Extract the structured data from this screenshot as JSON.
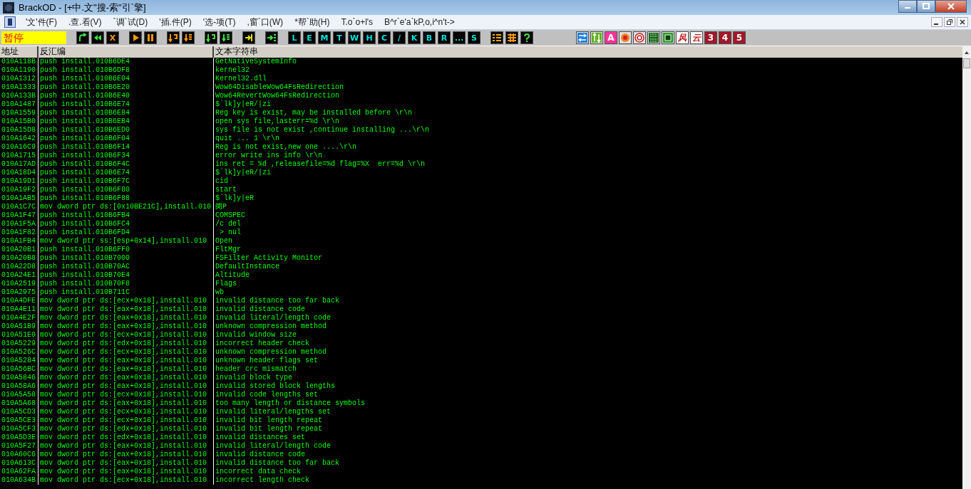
{
  "window": {
    "title": "BrackOD - [+中.文\"搜-索\"引`擎]"
  },
  "menu": [
    "'文'件(F)",
    ".查.看(V)",
    "`调`试(D)",
    "'插.件(P)",
    "'选-项(T)",
    ",窗`口(W)",
    "*帮`助(H)",
    "T.o`o+l's",
    "B^r`e'a`kP,o,i^n't->"
  ],
  "status": "暂停",
  "toolbar": [
    [
      {
        "kind": "curve-arrow"
      },
      {
        "kind": "rewind"
      },
      {
        "kind": "warn-letter",
        "label": "X"
      }
    ],
    [
      {
        "kind": "play"
      },
      {
        "kind": "pause"
      }
    ],
    [
      {
        "kind": "step-in"
      },
      {
        "kind": "step-over"
      }
    ],
    [
      {
        "kind": "trace-in"
      },
      {
        "kind": "trace-over"
      }
    ],
    [
      {
        "kind": "return"
      }
    ],
    [
      {
        "kind": "goto"
      }
    ],
    [
      {
        "kind": "letter",
        "label": "L"
      },
      {
        "kind": "letter",
        "label": "E"
      },
      {
        "kind": "letter",
        "label": "M"
      },
      {
        "kind": "letter",
        "label": "T"
      },
      {
        "kind": "letter",
        "label": "W"
      },
      {
        "kind": "letter",
        "label": "H"
      },
      {
        "kind": "letter",
        "label": "C"
      },
      {
        "kind": "letter",
        "label": "/"
      },
      {
        "kind": "letter",
        "label": "K"
      },
      {
        "kind": "letter",
        "label": "B"
      },
      {
        "kind": "letter",
        "label": "R"
      },
      {
        "kind": "letter",
        "label": "..."
      },
      {
        "kind": "letter",
        "label": "S"
      }
    ],
    [
      {
        "kind": "list"
      },
      {
        "kind": "grid"
      },
      {
        "kind": "help"
      }
    ]
  ],
  "toolbar_right": [
    {
      "kind": "swap"
    },
    {
      "kind": "updown"
    },
    {
      "kind": "badge",
      "label": "A",
      "color": "#ff3399"
    },
    {
      "kind": "record"
    },
    {
      "kind": "target"
    },
    {
      "kind": "binary"
    },
    {
      "kind": "chip"
    },
    {
      "kind": "calligraphy",
      "label": "风"
    },
    {
      "kind": "calligraphy",
      "label": "云"
    },
    {
      "kind": "badge",
      "label": "3",
      "color": "#a01828"
    },
    {
      "kind": "badge",
      "label": "4",
      "color": "#a01828"
    },
    {
      "kind": "badge",
      "label": "5",
      "color": "#a01828"
    }
  ],
  "table": {
    "columns": [
      "地址",
      "反汇编",
      "文本字符串"
    ],
    "rows": [
      [
        "010A118B",
        "push install.010B6DE4",
        "GetNativeSystemInfo"
      ],
      [
        "010A1190",
        "push install.010B6DF8",
        "kernel32"
      ],
      [
        "010A1312",
        "push install.010B6E04",
        "Kernel32.dll"
      ],
      [
        "010A1333",
        "push install.010B6E20",
        "Wow64DisableWow64FsRedirection"
      ],
      [
        "010A133B",
        "push install.010B6E40",
        "Wow64RevertWow64FsRedirection"
      ],
      [
        "010A1487",
        "push install.010B6E74",
        "$`lk]y|eR/|zi"
      ],
      [
        "010A1559",
        "push install.010B6E84",
        "Reg key is exist, may be installed before \\r\\n"
      ],
      [
        "010A15B0",
        "push install.010B6EB4",
        "open sys file,lasterr=%d \\r\\n"
      ],
      [
        "010A15D8",
        "push install.010B6ED0",
        "sys file is not exist ,continue installing ...\\r\\n"
      ],
      [
        "010A1642",
        "push install.010B6F04",
        "quit ... 1 \\r\\n"
      ],
      [
        "010A16C9",
        "push install.010B6F14",
        "Reg is not exist,new one ....\\r\\n"
      ],
      [
        "010A1715",
        "push install.010B6F34",
        "error write ins info \\r\\n"
      ],
      [
        "010A17AD",
        "push install.010B6F4C",
        "ins ret = %d ,releasefile=%d flag=%X  err=%d \\r\\n"
      ],
      [
        "010A18D4",
        "push install.010B6E74",
        "$`lk]y|eR/|zi"
      ],
      [
        "010A19D1",
        "push install.010B6F7C",
        "cid"
      ],
      [
        "010A19F2",
        "push install.010B6F80",
        "start"
      ],
      [
        "010A1AB5",
        "push install.010B6F88",
        "$`lk]y|eR"
      ],
      [
        "010A1C7C",
        "mov dword ptr ds:[0x10BE21C],install.010",
        "阌P"
      ],
      [
        "010A1F47",
        "push install.010B6FB4",
        "COMSPEC"
      ],
      [
        "010A1F5A",
        "push install.010B6FC4",
        "/c del"
      ],
      [
        "010A1F82",
        "push install.010B6FD4",
        " > nul"
      ],
      [
        "010A1FB4",
        "mov dword ptr ss:[esp+0x14],install.010",
        "Open"
      ],
      [
        "010A20B1",
        "push install.010B6FF0",
        "FltMgr"
      ],
      [
        "010A20B8",
        "push install.010B7000",
        "FSFilter Activity Monitor"
      ],
      [
        "010A22D8",
        "push install.010B70AC",
        "DefaultInstance"
      ],
      [
        "010A24E1",
        "push install.010B70E4",
        "Altitude"
      ],
      [
        "010A2519",
        "push install.010B70F8",
        "Flags"
      ],
      [
        "010A2975",
        "push install.010B711C",
        "wb"
      ],
      [
        "010A4DFE",
        "mov dword ptr ds:[ecx+0x18],install.010",
        "invalid distance too far back"
      ],
      [
        "010A4E11",
        "mov dword ptr ds:[eax+0x18],install.010",
        "invalid distance code"
      ],
      [
        "010A4E2F",
        "mov dword ptr ds:[eax+0x18],install.010",
        "invalid literal/length code"
      ],
      [
        "010A51B9",
        "mov dword ptr ds:[eax+0x18],install.010",
        "unknown compression method"
      ],
      [
        "010A51E0",
        "mov dword ptr ds:[ecx+0x18],install.010",
        "invalid window size"
      ],
      [
        "010A5229",
        "mov dword ptr ds:[edx+0x18],install.010",
        "incorrect header check"
      ],
      [
        "010A526C",
        "mov dword ptr ds:[ecx+0x18],install.010",
        "unknown compression method"
      ],
      [
        "010A5284",
        "mov dword ptr ds:[eax+0x18],install.010",
        "unknown header flags set"
      ],
      [
        "010A56BC",
        "mov dword ptr ds:[eax+0x18],install.010",
        "header crc mismatch"
      ],
      [
        "010A5846",
        "mov dword ptr ds:[eax+0x18],install.010",
        "invalid block type"
      ],
      [
        "010A58A6",
        "mov dword ptr ds:[eax+0x18],install.010",
        "invalid stored block lengths"
      ],
      [
        "010A5A58",
        "mov dword ptr ds:[ecx+0x18],install.010",
        "invalid code lengths set"
      ],
      [
        "010A5A68",
        "mov dword ptr ds:[eax+0x18],install.010",
        "too many length or distance symbols"
      ],
      [
        "010A5CD3",
        "mov dword ptr ds:[ecx+0x18],install.010",
        "invalid literal/lengths set"
      ],
      [
        "010A5CE3",
        "mov dword ptr ds:[ecx+0x18],install.010",
        "invalid bit length repeat"
      ],
      [
        "010A5CF3",
        "mov dword ptr ds:[edx+0x18],install.010",
        "invalid bit length repeat"
      ],
      [
        "010A5D3E",
        "mov dword ptr ds:[edx+0x18],install.010",
        "invalid distances set"
      ],
      [
        "010A5F27",
        "mov dword ptr ds:[eax+0x18],install.010",
        "invalid literal/length code"
      ],
      [
        "010A60C6",
        "mov dword ptr ds:[eax+0x18],install.010",
        "invalid distance code"
      ],
      [
        "010A613C",
        "mov dword ptr ds:[eax+0x18],install.010",
        "invalid distance too far back"
      ],
      [
        "010A62FA",
        "mov dword ptr ds:[eax+0x18],install.010",
        "incorrect data check"
      ],
      [
        "010A634B",
        "mov dword ptr ds:[ecx+0x18],install.010",
        "incorrect length check"
      ]
    ]
  }
}
